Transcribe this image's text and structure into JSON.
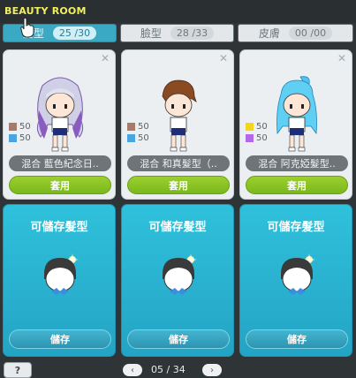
{
  "window": {
    "title": "BEAUTY ROOM"
  },
  "tabs": [
    {
      "label": "髮型",
      "count": "25 /30",
      "active": true
    },
    {
      "label": "臉型",
      "count": "28 /33",
      "active": false
    },
    {
      "label": "皮膚",
      "count": "00 /00",
      "active": false
    }
  ],
  "saved_hair": [
    {
      "name": "混合 藍色紀念日..",
      "colors": [
        {
          "color": "#a67b6a",
          "value": "50"
        },
        {
          "color": "#4aa4e0",
          "value": "50"
        }
      ],
      "apply_label": "套用",
      "hair": "silver-purple-long"
    },
    {
      "name": "混合 和真髮型（..",
      "colors": [
        {
          "color": "#a67b6a",
          "value": "50"
        },
        {
          "color": "#4aa4e0",
          "value": "50"
        }
      ],
      "apply_label": "套用",
      "hair": "brown-short"
    },
    {
      "name": "混合 阿克婭髮型..",
      "colors": [
        {
          "color": "#f4d51a",
          "value": "50"
        },
        {
          "color": "#b268e8",
          "value": "50"
        }
      ],
      "apply_label": "套用",
      "hair": "aqua-ponytail"
    }
  ],
  "storable_slots": [
    {
      "title": "可儲存髮型",
      "store_label": "儲存"
    },
    {
      "title": "可儲存髮型",
      "store_label": "儲存"
    },
    {
      "title": "可儲存髮型",
      "store_label": "儲存"
    }
  ],
  "pagination": {
    "help_label": "?",
    "prev": "‹",
    "page": "05 / 34",
    "next": "›"
  }
}
